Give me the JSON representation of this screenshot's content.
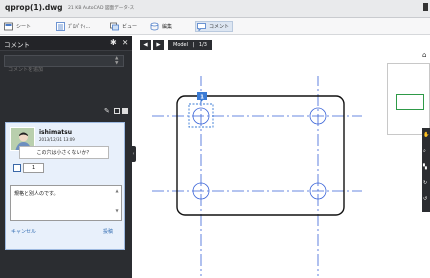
{
  "window": {
    "filename": "qprop(1).dwg",
    "subtitle": "21 KB AutoCAD 図面データ-ス"
  },
  "toolbar": {
    "items": [
      {
        "label": "シート"
      },
      {
        "label": "ﾌﾟﾛﾊﾟﾃｨ..."
      },
      {
        "label": "ビュー"
      },
      {
        "label": "編集"
      },
      {
        "label": "コメント"
      }
    ]
  },
  "panel": {
    "title": "コメント",
    "search_placeholder": "コメントを追加",
    "comment": {
      "user": "ishimatsu",
      "date": "2013/12/31 13:09",
      "text": "この穴は小さくないか？",
      "number": "1"
    },
    "reply_text": "規格と別人のです。",
    "cancel_label": "キャンセル",
    "post_label": "投稿"
  },
  "viewer": {
    "layout_label": "Model",
    "page_label": "1/3",
    "marker": "1"
  },
  "colors": {
    "panel": "#2b2d31",
    "accent": "#3a7bd5",
    "centerline": "#3a64d8"
  }
}
